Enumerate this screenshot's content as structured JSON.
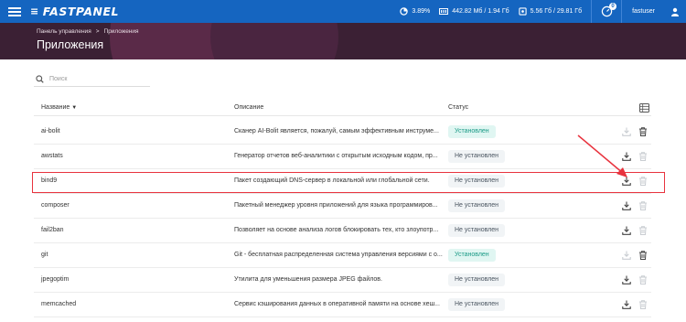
{
  "topbar": {
    "logo": "FASTPANEL",
    "cpu": "3.89%",
    "ram": "442.82 Мб / 1.94 Гб",
    "disk": "5.56 Гб / 29.81 Гб",
    "notifications": "0",
    "user": "fastuser"
  },
  "breadcrumb": {
    "home": "Панель управления",
    "separator": ">",
    "current": "Приложения"
  },
  "page_title": "Приложения",
  "search": {
    "placeholder": "Поиск"
  },
  "table": {
    "headers": {
      "name": "Название",
      "description": "Описание",
      "status": "Статус"
    },
    "rows": [
      {
        "name": "ai-bolit",
        "description": "Сканер AI-Bolit является, пожалуй, самым эффективным инструме...",
        "status": "Установлен",
        "installed": true
      },
      {
        "name": "awstats",
        "description": "Генератор отчетов веб-аналитики с открытым исходным кодом, пр...",
        "status": "Не установлен",
        "installed": false
      },
      {
        "name": "bind9",
        "description": "Пакет создающий DNS-сервер в локальной или глобальной сети.",
        "status": "Не установлен",
        "installed": false
      },
      {
        "name": "composer",
        "description": "Пакетный менеджер уровня приложений для языка программиров...",
        "status": "Не установлен",
        "installed": false
      },
      {
        "name": "fail2ban",
        "description": "Позволяет на основе анализа логов блокировать тех, кто злоупотр...",
        "status": "Не установлен",
        "installed": false
      },
      {
        "name": "git",
        "description": "Git - бесплатная распределенная система управления версиями с о...",
        "status": "Установлен",
        "installed": true
      },
      {
        "name": "jpegoptim",
        "description": "Утилита для уменьшения размера JPEG файлов.",
        "status": "Не установлен",
        "installed": false
      },
      {
        "name": "memcached",
        "description": "Сервис кэширования данных в оперативной памяти на основе хеш...",
        "status": "Не установлен",
        "installed": false
      }
    ]
  },
  "colors": {
    "topbar": "#1565c0",
    "header": "#3b2034",
    "installed": "#1a9a86",
    "highlight": "#e8333e"
  },
  "icons": [
    "menu-icon",
    "cpu-icon",
    "ram-icon",
    "disk-icon",
    "gauge-icon",
    "user-icon",
    "search-icon",
    "sort-down-icon",
    "columns-icon",
    "download-icon",
    "trash-icon"
  ]
}
